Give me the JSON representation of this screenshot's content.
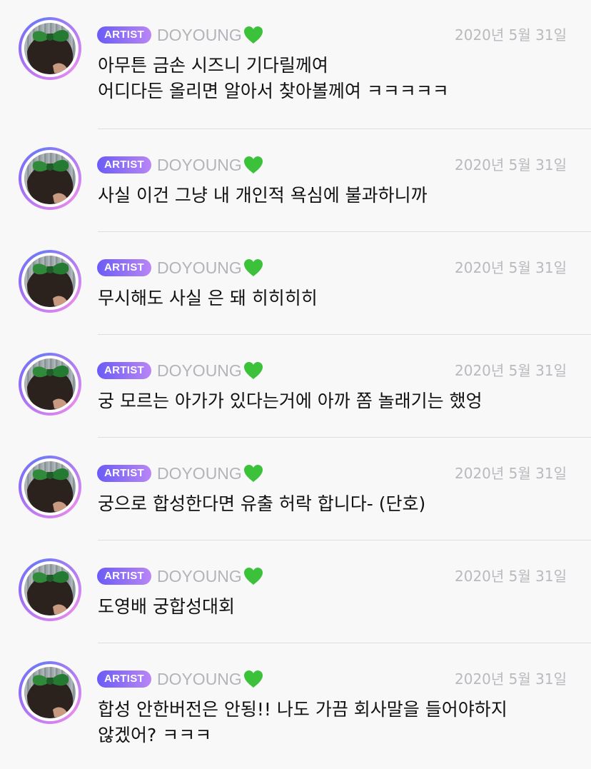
{
  "colors": {
    "badge_gradient_start": "#6a5cf6",
    "badge_gradient_end": "#b985f5",
    "username": "#b3b3b9",
    "date": "#b9b9be",
    "text": "#111114",
    "divider": "#dedee2",
    "heart": "#3cc13b"
  },
  "comments": [
    {
      "badge": "ARTIST",
      "username": "DOYOUNG",
      "heart_icon": "green-heart-icon",
      "date": "2020년 5월 31일",
      "lines": [
        "아무튼 금손 시즈니 기다릴께여",
        "어디다든 올리면 알아서 찾아볼께여 ㅋㅋㅋㅋㅋ"
      ]
    },
    {
      "badge": "ARTIST",
      "username": "DOYOUNG",
      "heart_icon": "green-heart-icon",
      "date": "2020년 5월 31일",
      "lines": [
        "사실 이건 그냥 내 개인적 욕심에 불과하니까"
      ]
    },
    {
      "badge": "ARTIST",
      "username": "DOYOUNG",
      "heart_icon": "green-heart-icon",
      "date": "2020년 5월 31일",
      "lines": [
        "무시해도 사실 은 돼 히히히히"
      ]
    },
    {
      "badge": "ARTIST",
      "username": "DOYOUNG",
      "heart_icon": "green-heart-icon",
      "date": "2020년 5월 31일",
      "lines": [
        "궁 모르는 아가가 있다는거에 아까 쫌 놀래기는 했엉"
      ]
    },
    {
      "badge": "ARTIST",
      "username": "DOYOUNG",
      "heart_icon": "green-heart-icon",
      "date": "2020년 5월 31일",
      "lines": [
        "궁으로 합성한다면 유출 허락 합니다- (단호)"
      ]
    },
    {
      "badge": "ARTIST",
      "username": "DOYOUNG",
      "heart_icon": "green-heart-icon",
      "date": "2020년 5월 31일",
      "lines": [
        "도영배 궁합성대회"
      ]
    },
    {
      "badge": "ARTIST",
      "username": "DOYOUNG",
      "heart_icon": "green-heart-icon",
      "date": "2020년 5월 31일",
      "lines": [
        "합성 안한버전은 안됭!! 나도 가끔 회사말을 들어야하지",
        "않겠어? ㅋㅋㅋ"
      ]
    }
  ]
}
